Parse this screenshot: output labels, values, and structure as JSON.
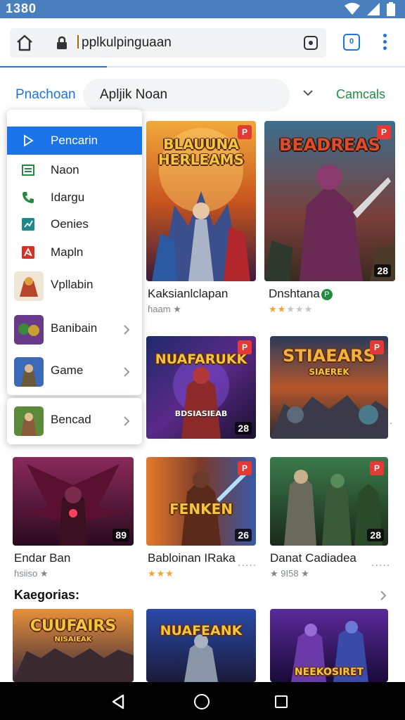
{
  "status_bar": {
    "time": "1380"
  },
  "browser": {
    "url": "pplkulpinguaan",
    "tab_count": "0"
  },
  "toolbar": {
    "title": "Pnachoan",
    "search_text": "Apljik Noan",
    "right_link": "Camcals"
  },
  "menu": {
    "items": [
      {
        "label": "Pencarin",
        "icon": "play-store-icon",
        "active": true
      },
      {
        "label": "Naon",
        "icon": "list-icon"
      },
      {
        "label": "Idargu",
        "icon": "phone-icon"
      },
      {
        "label": "Oenies",
        "icon": "chart-icon"
      },
      {
        "label": "Mapln",
        "icon": "puzzle-icon"
      }
    ],
    "apps": [
      {
        "label": "Vpllabin"
      },
      {
        "label": "Banibain"
      },
      {
        "label": "Game"
      },
      {
        "label": "Bencad"
      }
    ]
  },
  "grid": {
    "row1": [
      {
        "art_title": "BLAUUNA HERLEAMS",
        "name": "Kaksianlclapan",
        "sub": "ɦaam ★",
        "tag": "P"
      },
      {
        "art_title": "BEADREAS",
        "name": "Dnshtana",
        "rating": 2,
        "badge": "28",
        "tag": "P"
      }
    ],
    "row2": [
      {
        "art_title": "NUAFARUKK",
        "badge": "28",
        "tag": "P",
        "caption": "BDSIASIEAB"
      },
      {
        "art_title": "STIAEARS",
        "caption": "SIAEREK",
        "tag": "P"
      }
    ],
    "row3": [
      {
        "badge": "89",
        "name": "Endar Ban",
        "sub": "ɦsiiso ★"
      },
      {
        "art_title": "FENKEN",
        "badge": "26",
        "tag": "P",
        "name": "Babloinan IRaka",
        "rating": 3,
        "more": "....."
      },
      {
        "badge": "28",
        "tag": "P",
        "name": "Danat Cadiadea",
        "sub": "★ 9I58 ★",
        "more": "....."
      }
    ],
    "row1_more": "....."
  },
  "section": {
    "title": "Kaegorias:"
  },
  "bottom_row": [
    {
      "art_title": "CUUFAIRS",
      "caption": "NISAIEAK"
    },
    {
      "art_title": "NUAFEANK"
    },
    {
      "caption": "NEEKOSIRET"
    }
  ]
}
